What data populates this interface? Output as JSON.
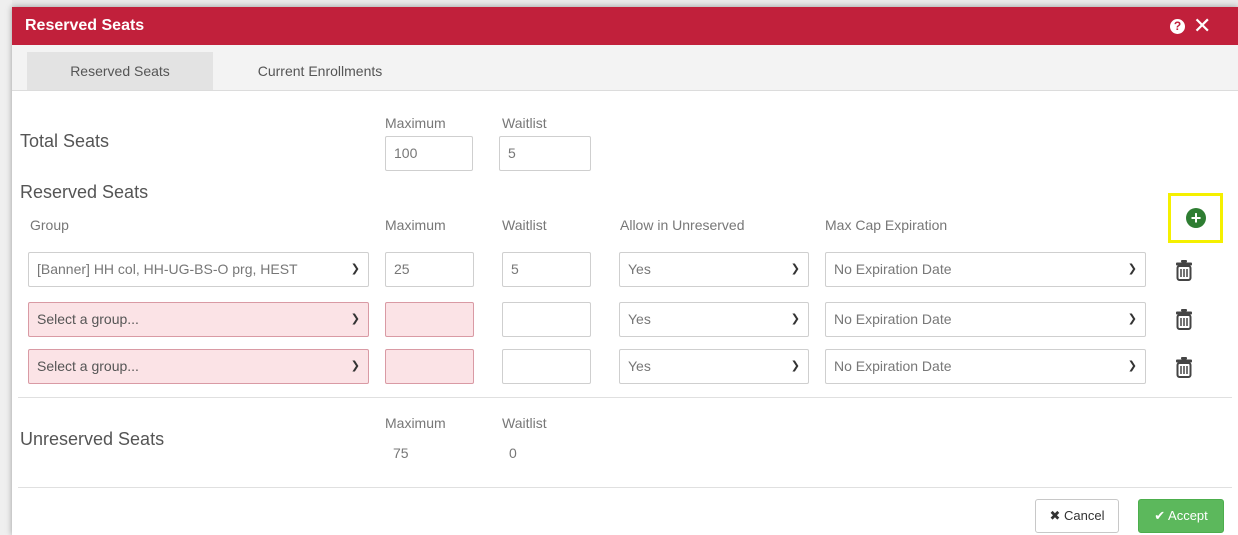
{
  "modal": {
    "title": "Reserved Seats",
    "help_icon": "question-circle-icon",
    "close_icon": "close-x-icon"
  },
  "tabs": [
    {
      "label": "Reserved Seats",
      "active": true
    },
    {
      "label": "Current Enrollments",
      "active": false
    }
  ],
  "total_seats": {
    "title": "Total Seats",
    "maximum_label": "Maximum",
    "waitlist_label": "Waitlist",
    "maximum_value": "100",
    "waitlist_value": "5"
  },
  "reserved_seats": {
    "title": "Reserved Seats",
    "columns": {
      "group": "Group",
      "maximum": "Maximum",
      "waitlist": "Waitlist",
      "allow_unreserved": "Allow in Unreserved",
      "max_cap_expiration": "Max Cap Expiration"
    },
    "add_icon": "plus-circle-icon",
    "rows": [
      {
        "group": "[Banner] HH col, HH-UG-BS-O prg, HEST",
        "maximum": "25",
        "waitlist": "5",
        "allow_unreserved": "Yes",
        "expiration": "No Expiration Date"
      },
      {
        "group": "Select a group...",
        "maximum": "",
        "waitlist": "",
        "allow_unreserved": "Yes",
        "expiration": "No Expiration Date"
      },
      {
        "group": "Select a group...",
        "maximum": "",
        "waitlist": "",
        "allow_unreserved": "Yes",
        "expiration": "No Expiration Date"
      }
    ]
  },
  "unreserved_seats": {
    "title": "Unreserved Seats",
    "maximum_label": "Maximum",
    "waitlist_label": "Waitlist",
    "maximum_value": "75",
    "waitlist_value": "0"
  },
  "buttons": {
    "cancel": "Cancel",
    "accept": "Accept"
  },
  "colors": {
    "title_bar": "#c1203b",
    "accept": "#5cb85c",
    "error_fill": "#fbe3e6",
    "add_icon": "#2e7d32",
    "highlight": "#f5f000"
  }
}
